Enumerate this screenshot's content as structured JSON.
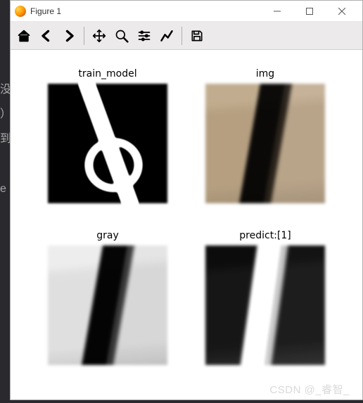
{
  "window": {
    "title": "Figure 1"
  },
  "toolbar": {
    "home": "Home",
    "back": "Back",
    "forward": "Forward",
    "pan": "Pan",
    "zoom": "Zoom",
    "configure": "Configure subplots",
    "edit": "Edit axis",
    "save": "Save"
  },
  "plots": [
    {
      "title": "train_model"
    },
    {
      "title": "img"
    },
    {
      "title": "gray"
    },
    {
      "title": "predict:[1]"
    }
  ],
  "watermark": "CSDN @_睿智_",
  "chart_data": {
    "type": "image_grid",
    "rows": 2,
    "cols": 2,
    "panels": [
      {
        "index": 1,
        "title": "train_model",
        "content": "handwritten digit sample (digit 6, white on black, MNIST-style)",
        "cmap": "gray"
      },
      {
        "index": 2,
        "title": "img",
        "content": "color photo of handwritten digit 1 (dark stroke on beige paper)",
        "cmap": "color"
      },
      {
        "index": 3,
        "title": "gray",
        "content": "grayscale conversion of the digit-1 photo (dark stroke on light background)",
        "cmap": "gray"
      },
      {
        "index": 4,
        "title": "predict:[1]",
        "content": "preprocessed/inverted digit-1 image fed to model, predicted class = 1 (white stroke on black)",
        "cmap": "gray"
      }
    ],
    "prediction": 1
  }
}
